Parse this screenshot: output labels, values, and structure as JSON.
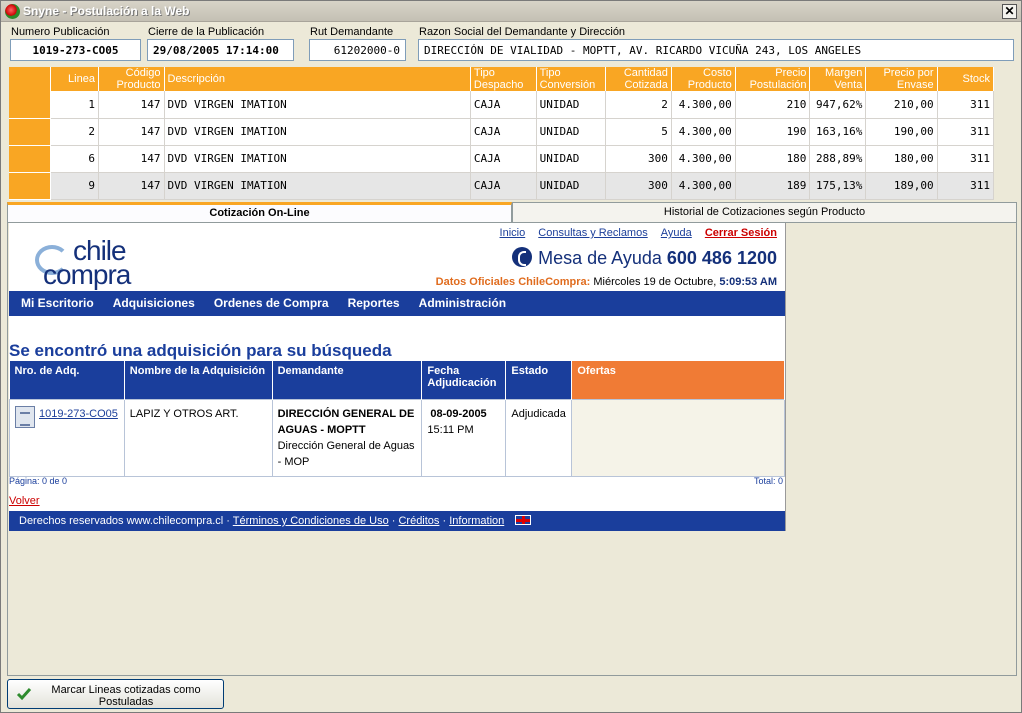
{
  "window": {
    "title": "Snyne - Postulación a la Web"
  },
  "header": {
    "numero_label": "Numero Publicación",
    "numero_value": "1019-273-CO05",
    "cierre_label": "Cierre de la Publicación",
    "cierre_value": "29/08/2005 17:14:00",
    "rut_label": "Rut Demandante",
    "rut_value": "61202000-0",
    "razon_label": "Razon Social del Demandante y Dirección",
    "razon_value": "DIRECCIÓN DE VIALIDAD - MOPTT, AV. RICARDO VICUÑA 243, LOS ANGELES"
  },
  "grid": {
    "columns": [
      "Linea",
      "Código Producto",
      "Descripción",
      "Tipo Despacho",
      "Tipo Conversión",
      "Cantidad Cotizada",
      "Costo Producto",
      "Precio Postulación",
      "Margen Venta",
      "Precio por Envase",
      "Stock"
    ],
    "rows": [
      [
        "1",
        "147",
        "DVD VIRGEN IMATION",
        "CAJA",
        "UNIDAD",
        "2",
        "4.300,00",
        "210",
        "947,62%",
        "210,00",
        "311"
      ],
      [
        "2",
        "147",
        "DVD VIRGEN IMATION",
        "CAJA",
        "UNIDAD",
        "5",
        "4.300,00",
        "190",
        "163,16%",
        "190,00",
        "311"
      ],
      [
        "6",
        "147",
        "DVD VIRGEN IMATION",
        "CAJA",
        "UNIDAD",
        "300",
        "4.300,00",
        "180",
        "288,89%",
        "180,00",
        "311"
      ],
      [
        "9",
        "147",
        "DVD VIRGEN IMATION",
        "CAJA",
        "UNIDAD",
        "300",
        "4.300,00",
        "189",
        "175,13%",
        "189,00",
        "311"
      ]
    ]
  },
  "tabs": {
    "active": "Cotización On-Line",
    "other": "Historial de Cotizaciones según Producto"
  },
  "web": {
    "logo_top": "chile",
    "logo_bottom": "compra",
    "links": {
      "inicio": "Inicio",
      "consultas": "Consultas y Reclamos",
      "ayuda": "Ayuda",
      "cerrar": "Cerrar Sesión"
    },
    "help_text": "Mesa de Ayuda",
    "help_phone": "600 486 1200",
    "datos_label": "Datos Oficiales ChileCompra:",
    "datos_date": "Miércoles 19 de Octubre,",
    "datos_time": "5:09:53 AM",
    "menu": [
      "Mi Escritorio",
      "Adquisiciones",
      "Ordenes de Compra",
      "Reportes",
      "Administración"
    ],
    "search_title": "Se encontró una adquisición para su búsqueda",
    "result_headers": [
      "Nro. de Adq.",
      "Nombre de la Adquisición",
      "Demandante",
      "Fecha Adjudicación",
      "Estado",
      "Ofertas"
    ],
    "result_row": {
      "nro": "1019-273-CO05",
      "nombre": "LAPIZ Y OTROS ART.",
      "demandante_bold": "DIRECCIÓN GENERAL DE AGUAS - MOPTT",
      "demandante_sub": "Dirección General de Aguas - MOP",
      "fecha": "08-09-2005",
      "hora": "15:11 PM",
      "estado": "Adjudicada"
    },
    "pagina": "Página: 0 de 0",
    "total": "Total: 0",
    "volver": "Volver",
    "footer_text": "Derechos reservados www.chilecompra.cl ·",
    "footer_links": [
      "Términos y Condiciones de Uso",
      "Créditos",
      "Information"
    ]
  },
  "bottom_button": {
    "label": "Marcar Lineas cotizadas como Postuladas"
  },
  "colors": {
    "grid_header": "#f9a623",
    "web_blue": "#1a3e9c",
    "ofertas_orange": "#f07b35"
  }
}
